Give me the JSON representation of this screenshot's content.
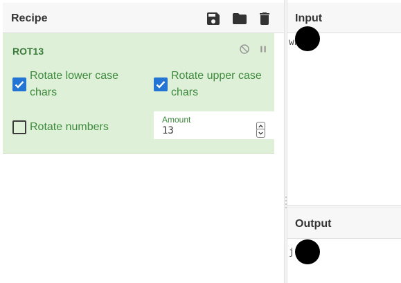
{
  "recipe": {
    "title": "Recipe",
    "icons": [
      "save-icon",
      "folder-icon",
      "trash-icon"
    ]
  },
  "operation": {
    "name": "ROT13",
    "controls": [
      "disable-icon",
      "pause-icon"
    ],
    "options": {
      "rotate_lower": {
        "label": "Rotate lower case chars",
        "checked": true
      },
      "rotate_upper": {
        "label": "Rotate upper case chars",
        "checked": true
      },
      "rotate_numbers": {
        "label": "Rotate numbers",
        "checked": false
      }
    },
    "amount": {
      "label": "Amount",
      "value": "13"
    }
  },
  "input": {
    "title": "Input",
    "text": "wh"
  },
  "output": {
    "title": "Output",
    "text": "j"
  },
  "colors": {
    "card_bg": "#dff0d8",
    "label_green": "#3c8a3c",
    "checkbox_blue": "#2374d3"
  }
}
